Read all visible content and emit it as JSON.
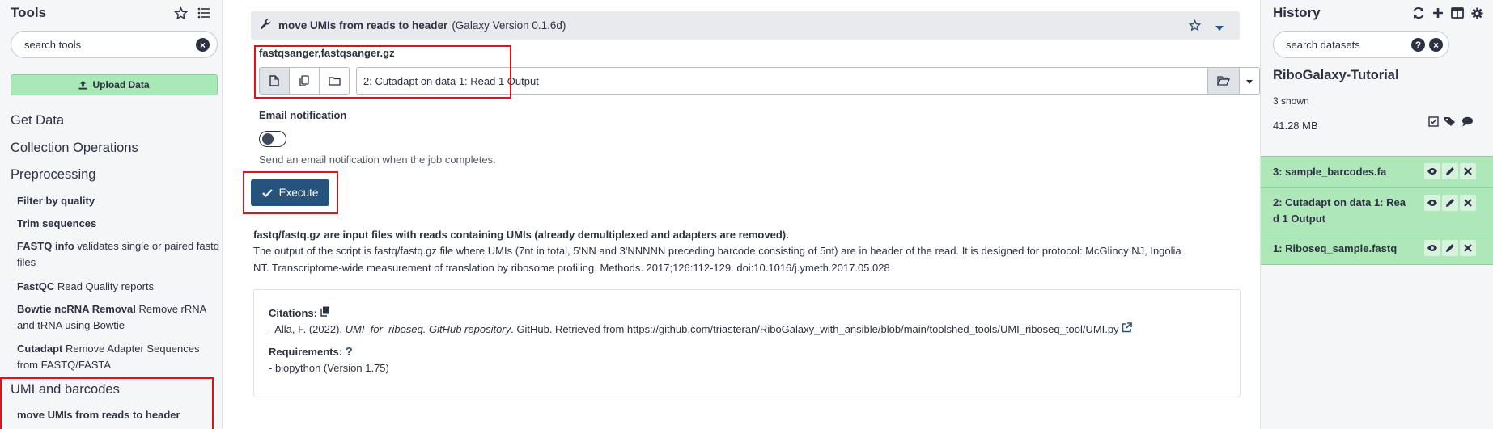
{
  "tool_panel": {
    "title": "Tools",
    "search_placeholder": "search tools",
    "upload_label": "Upload Data",
    "sections": [
      "Get Data",
      "Collection Operations",
      "Preprocessing",
      "UMI and barcodes"
    ],
    "tools": [
      {
        "name": "Filter by quality",
        "desc": ""
      },
      {
        "name": "Trim sequences",
        "desc": ""
      },
      {
        "name": "FASTQ info",
        "desc": "validates single or paired fastq files"
      },
      {
        "name": "FastQC",
        "desc": "Read Quality reports"
      },
      {
        "name": "Bowtie ncRNA Removal",
        "desc": "Remove rRNA and tRNA using Bowtie"
      },
      {
        "name": "Cutadapt",
        "desc": "Remove Adapter Sequences from FASTQ/FASTA"
      },
      {
        "name": "move UMIs from reads to header",
        "desc": ""
      }
    ]
  },
  "form": {
    "tool_name": "move UMIs from reads to header",
    "tool_version": "(Galaxy Version 0.1.6d)",
    "input_formats": "fastqsanger,fastqsanger.gz",
    "input_selected": "2: Cutadapt on data 1: Read 1 Output",
    "email_label": "Email notification",
    "email_hint": "Send an email notification when the job completes.",
    "execute_label": "Execute",
    "help_bold": "fastq/fastq.gz are input files with reads containing UMIs (already demultiplexed and adapters are removed).",
    "help_line1": "The output of the script is fastq/fastq.gz file where UMIs (7nt in total, 5'NN and 3'NNNNN preceding barcode consisting of 5nt) are in header of the read. It is designed for protocol: McGlincy NJ, Ingolia",
    "help_line2": "NT. Transcriptome-wide measurement of translation by ribosome profiling. Methods. 2017;126:112-129. doi:10.1016/j.ymeth.2017.05.028",
    "citations_label": "Citations:",
    "citation_prefix": "- Alla, F. (2022). ",
    "citation_italic": "UMI_for_riboseq. GitHub repository",
    "citation_suffix": ". GitHub. Retrieved from https://github.com/triasteran/RiboGalaxy_with_ansible/blob/main/toolshed_tools/UMI_riboseq_tool/UMI.py",
    "requirements_label": "Requirements:",
    "requirement": "- biopython (Version 1.75)"
  },
  "history": {
    "title": "History",
    "search_placeholder": "search datasets",
    "name": "RiboGalaxy-Tutorial",
    "shown": "3 shown",
    "size": "41.28 MB",
    "datasets": [
      {
        "title_line1": "3: sample_barcodes.fa",
        "title_line2": ""
      },
      {
        "title_line1": "2: Cutadapt on data 1: Rea",
        "title_line2": "d 1 Output"
      },
      {
        "title_line1": "1: Riboseq_sample.fastq",
        "title_line2": ""
      }
    ]
  },
  "colors": {
    "accent": "#25537b",
    "dataset_ok": "#aee8b9",
    "upload": "#a9e9b8",
    "highlight": "#e3121a"
  }
}
